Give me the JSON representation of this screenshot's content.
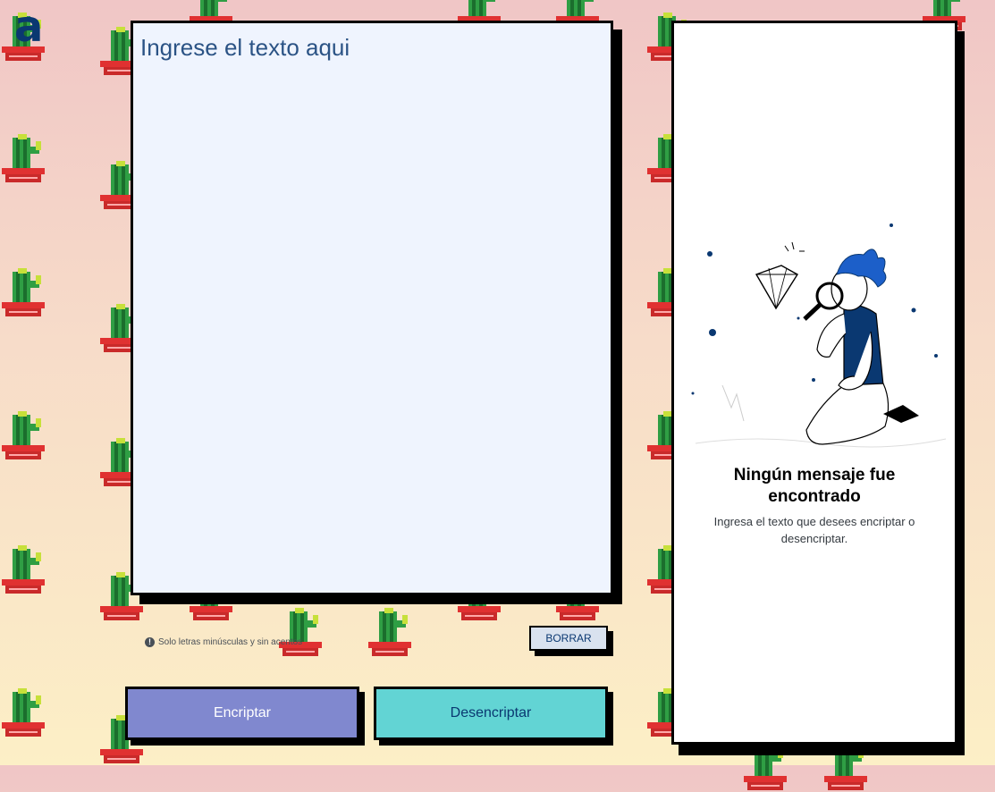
{
  "app": {
    "logo_letter": "a"
  },
  "editor": {
    "placeholder": "Ingrese el texto aqui"
  },
  "hint": {
    "icon": "exclamation-circle-icon",
    "text": "Solo letras minúsculas y sin acentos"
  },
  "buttons": {
    "clear_label": "BORRAR",
    "encrypt_label": "Encriptar",
    "decrypt_label": "Desencriptar"
  },
  "output_panel": {
    "illustration": "person-with-magnifier-illustration",
    "title": "Ningún mensaje fue encontrado",
    "text": "Ingresa el texto que desees encriptar o desencriptar."
  },
  "colors": {
    "accent": "#0a3871",
    "encrypt_button": "#8088cf",
    "decrypt_button": "#62d4d4",
    "clear_button": "#d9e2ef",
    "editor_bg": "#eff4fe"
  }
}
